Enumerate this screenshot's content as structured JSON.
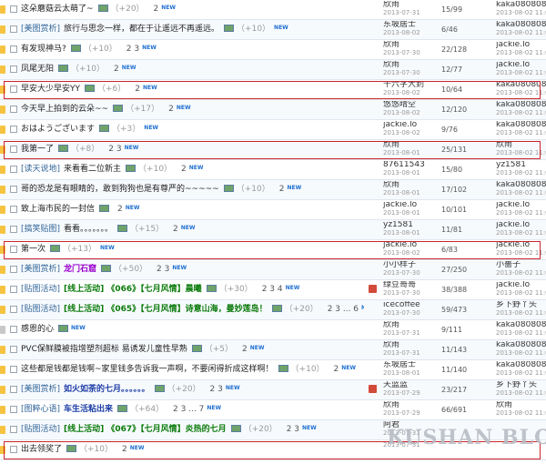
{
  "watermark": "KUSHAN BLOG",
  "rows": [
    {
      "title": "这朵蘑菇云太萌了~",
      "rate": "（+20）",
      "pages": "2",
      "author": "欣雨",
      "date": "2013-07-31",
      "counts": "15/99",
      "last": "kaka080808",
      "ldate": "2013-08-02 11:06",
      "color": "",
      "cat": ""
    },
    {
      "cat": "[美图赏析]",
      "title": "旅行与思念一样，都在于让遥远不再遥远。",
      "rate": "（+10）",
      "pages": "",
      "author": "东坡居士",
      "date": "2013-08-02",
      "counts": "6/46",
      "last": "kaka080808",
      "ldate": "2013-08-02 11:06",
      "color": ""
    },
    {
      "title": "有发现神马?",
      "rate": "（+10）",
      "pages": "2 3",
      "author": "欣雨",
      "date": "2013-07-30",
      "counts": "22/128",
      "last": "jackie.lo",
      "ldate": "2013-08-02 11:06",
      "color": "",
      "cat": ""
    },
    {
      "title": "凤尾无阳",
      "rate": "（+10）",
      "pages": "2",
      "author": "欣雨",
      "date": "2013-07-30",
      "counts": "12/77",
      "last": "jackie.lo",
      "ldate": "2013-08-02 11:06",
      "color": "",
      "cat": ""
    },
    {
      "title": "早安大少早安YY",
      "rate": "（+6）",
      "pages": "2",
      "author": "十六字大刲",
      "date": "2013-08-02",
      "counts": "10/64",
      "last": "kaka080808",
      "ldate": "2013-08-02 11:06",
      "color": "",
      "cat": ""
    },
    {
      "title": "今天早上拍到的云朵~~",
      "rate": "（+17）",
      "pages": "2",
      "author": "悠悠晴空",
      "date": "2013-08-02",
      "counts": "12/120",
      "last": "kaka080808",
      "ldate": "2013-08-02 11:06",
      "color": "",
      "cat": ""
    },
    {
      "title": "おはようございます",
      "rate": "（+3）",
      "pages": "",
      "author": "jackie.lo",
      "date": "2013-08-02",
      "counts": "9/76",
      "last": "kaka080808",
      "ldate": "2013-08-02 11:06",
      "color": "",
      "cat": ""
    },
    {
      "title": "我第一了",
      "rate": "（+8）",
      "pages": "2 3",
      "author": "欣雨",
      "date": "2013-08-01",
      "counts": "25/131",
      "last": "欣雨",
      "ldate": "2013-08-02 11:06",
      "color": "",
      "cat": ""
    },
    {
      "cat": "[读天说地]",
      "title": "来看看二位新主",
      "rate": "（+10）",
      "pages": "2",
      "author": "87611543",
      "date": "2013-08-01",
      "counts": "15/80",
      "last": "yz1581",
      "ldate": "2013-08-02 11:06",
      "color": ""
    },
    {
      "title": "哥的恐龙是有眼睛的，敢到狗狗也是有尊严的~~~~~",
      "rate": "（+10）",
      "pages": "2",
      "author": "欣雨",
      "date": "2013-08-01",
      "counts": "17/102",
      "last": "kaka080808",
      "ldate": "2013-08-02 11:06",
      "color": "",
      "cat": ""
    },
    {
      "title": "致上海市民的一封信",
      "rate": "",
      "pages": "2",
      "author": "jackie.lo",
      "date": "2013-08-01",
      "counts": "10/101",
      "last": "jackie.lo",
      "ldate": "2013-08-02 11:06",
      "color": "",
      "cat": ""
    },
    {
      "cat": "[搞笑贴图]",
      "title": "看看。。。。。。。",
      "rate": "（+15）",
      "pages": "2",
      "author": "yz1581",
      "date": "2013-08-01",
      "counts": "11/81",
      "last": "jackie.lo",
      "ldate": "2013-08-02 11:06",
      "color": ""
    },
    {
      "title": "第一次",
      "rate": "（+13）",
      "pages": "",
      "author": "jackie.lo",
      "date": "2013-08-02",
      "counts": "6/83",
      "last": "jackie.lo",
      "ldate": "2013-08-02 11:06",
      "color": "",
      "cat": ""
    },
    {
      "cat": "[美图赏析]",
      "title": "龙门石窟",
      "rate": "（+50）",
      "pages": "2 3",
      "author": "小小样子",
      "date": "2013-07-30",
      "counts": "27/250",
      "last": "小薔子",
      "ldate": "2013-08-02 11:06",
      "color": "purple"
    },
    {
      "cat": "[贴图活动]",
      "title": "[线上活动] 《066》【七月风情】晨曦",
      "rate": "（+30）",
      "pages": "2 3 4",
      "author": "绿豆哥哥",
      "date": "2013-07-30",
      "counts": "38/388",
      "last": "jackie.lo",
      "ldate": "2013-08-02 11:06",
      "color": "green"
    },
    {
      "cat": "[贴图活动]",
      "title": "[线上活动] 《065》【七月风情】诗意山海，曼妙莲岛！",
      "rate": "（+20）",
      "pages": "2 3 ... 6",
      "author": "icecoffee",
      "date": "2013-07-30",
      "counts": "59/473",
      "last": "乡下野丫头",
      "ldate": "2013-08-02 11:06",
      "color": "green"
    },
    {
      "title": "感恩的心",
      "rate": "",
      "pages": "",
      "author": "欣雨",
      "date": "2013-07-31",
      "counts": "9/111",
      "last": "kaka080808",
      "ldate": "2013-08-02 11:06",
      "color": "",
      "cat": ""
    },
    {
      "title": "PVC保鲜膜被指增塑剂超标 易诱发儿童性早熟",
      "rate": "（+5）",
      "pages": "2",
      "author": "欣雨",
      "date": "2013-07-31",
      "counts": "11/143",
      "last": "kaka080808",
      "ldate": "2013-08-02 11:06",
      "color": "",
      "cat": ""
    },
    {
      "title": "这些都是钱都是钱啊~家里钱多告诉我一声啊，不要闲得折成这样啊！",
      "rate": "（+10）",
      "pages": "2",
      "author": "东坡居士",
      "date": "2013-08-01",
      "counts": "11/140",
      "last": "kaka080808",
      "ldate": "2013-08-02 11:06",
      "color": "",
      "cat": ""
    },
    {
      "cat": "[美图赏析]",
      "title": "如火如荼的七月。。。。。。",
      "rate": "（+20）",
      "pages": "2 3",
      "author": "天蓝蓝",
      "date": "2013-07-29",
      "counts": "23/217",
      "last": "乡下野丫头",
      "ldate": "2013-08-02 11:06",
      "color": "blue"
    },
    {
      "cat": "[图粹心语]",
      "title": "车生活粘出来",
      "rate": "（+64）",
      "pages": "2 3 ... 7",
      "author": "欣雨",
      "date": "2013-07-29",
      "counts": "66/691",
      "last": "欣雨",
      "ldate": "2013-08-02 11:06",
      "color": "blue"
    },
    {
      "cat": "[贴图活动]",
      "title": "[线上活动] 《067》【七月风情】炎热的七月",
      "rate": "（+20）",
      "pages": "2 3",
      "author": "阿君",
      "date": "2013-07-31",
      "counts": "",
      "last": "",
      "ldate": "",
      "color": "green"
    },
    {
      "title": "出去领奖了",
      "rate": "（+10）",
      "pages": "2",
      "author": "",
      "date": "2013-07-31",
      "counts": "",
      "last": "",
      "ldate": "",
      "color": "",
      "cat": ""
    }
  ]
}
